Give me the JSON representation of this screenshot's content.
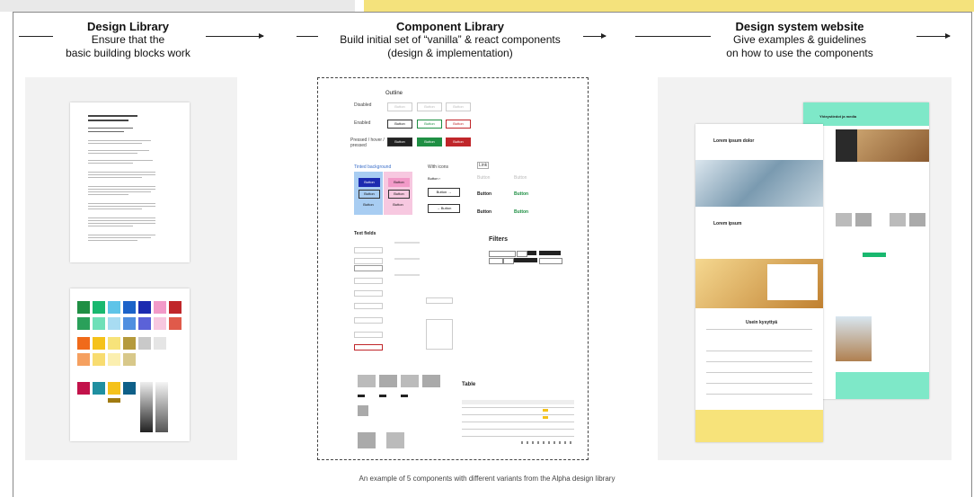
{
  "columns": [
    {
      "title": "Design Library",
      "lines": [
        "Ensure that the",
        "basic building blocks work"
      ]
    },
    {
      "title": "Component Library",
      "lines": [
        "Build initial set of “vanilla” & react components",
        "(design & implementation)"
      ]
    },
    {
      "title": "Design system website",
      "lines": [
        "Give examples & guidelines",
        "on how to use the components"
      ]
    }
  ],
  "caption": "An example of 5 components with different variants from the Alpha design library",
  "component_sheet": {
    "outline_label": "Outline",
    "row_labels": [
      "Disabled",
      "Enabled",
      "Pressed / hover / pressed"
    ],
    "button_text": "Button",
    "text_fields_label": "Text fields",
    "filters_label": "Filters",
    "table_label": "Table",
    "tinted_label": "Tinted background",
    "icons_label": "With icons",
    "link_label": "Link"
  },
  "website": {
    "hero_title": "Lorem ipsum dolor",
    "section_title": "Lorem ipsum",
    "faq_title": "Usein kysyttyä",
    "fi_title": "Yhteystiedot ja media"
  },
  "colors": {
    "mint": "#7ee8c8",
    "yellow": "#f7e37a",
    "green": "#1f8f44",
    "red": "#c0262a"
  }
}
